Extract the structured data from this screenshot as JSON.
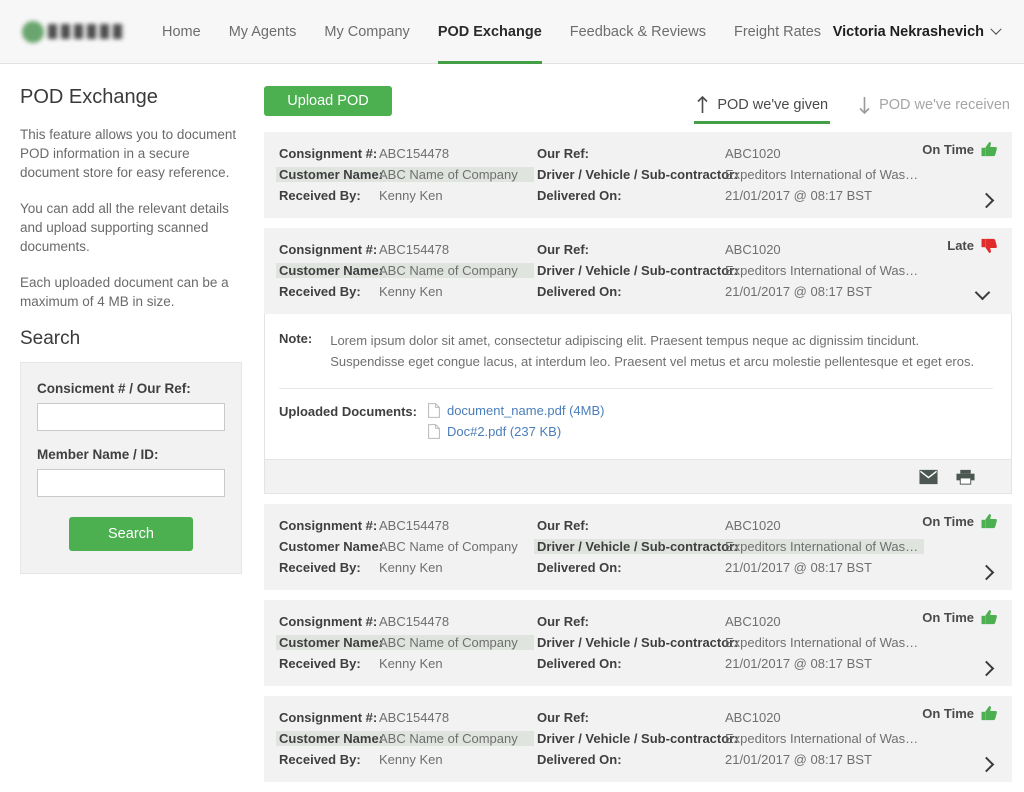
{
  "header": {
    "logo_name": "company-logo",
    "nav": [
      {
        "label": "Home",
        "active": false
      },
      {
        "label": "My Agents",
        "active": false
      },
      {
        "label": "My Company",
        "active": false
      },
      {
        "label": "POD Exchange",
        "active": true
      },
      {
        "label": "Feedback & Reviews",
        "active": false
      },
      {
        "label": "Freight Rates",
        "active": false
      }
    ],
    "user_name": "Victoria Nekrashevich"
  },
  "sidebar": {
    "title": "POD Exchange",
    "paragraphs": [
      "This feature allows you to document POD information in a secure document store for easy reference.",
      "You can add all the relevant details and upload supporting scanned documents.",
      "Each uploaded document can be a maximum of 4 MB in size."
    ],
    "search_heading": "Search",
    "consignment_label": "Consicment # / Our Ref:",
    "consignment_value": "",
    "member_label": "Member Name / ID:",
    "member_value": "",
    "search_button": "Search"
  },
  "toolbar": {
    "upload_label": "Upload POD",
    "tabs": [
      {
        "label": "POD we've given",
        "icon": "arrow-up-icon",
        "active": true
      },
      {
        "label": "POD we've receiven",
        "icon": "arrow-down-icon",
        "active": false
      }
    ]
  },
  "labels": {
    "consignment": "Consignment #:",
    "customer": "Customer Name:",
    "received_by": "Received By:",
    "our_ref": "Our Ref:",
    "driver": "Driver / Vehicle / Sub-contractor:",
    "delivered_on": "Delivered On:",
    "note": "Note:",
    "uploaded_documents": "Uploaded Documents:"
  },
  "records": [
    {
      "consignment": "ABC154478",
      "customer": "ABC Name of Company",
      "received_by": "Kenny Ken",
      "our_ref": "ABC1020",
      "driver": "Expeditors International of Washi...",
      "delivered_on": "21/01/2017 @ 08:17 BST",
      "status": "On Time",
      "status_type": "ontime",
      "highlight": "customer",
      "expanded": false
    },
    {
      "consignment": "ABC154478",
      "customer": "ABC Name of Company",
      "received_by": "Kenny Ken",
      "our_ref": "ABC1020",
      "driver": "Expeditors International of Washi...",
      "delivered_on": "21/01/2017 @ 08:17 BST",
      "status": "Late",
      "status_type": "late",
      "highlight": "customer",
      "expanded": true
    },
    {
      "consignment": "ABC154478",
      "customer": "ABC Name of Company",
      "received_by": "Kenny Ken",
      "our_ref": "ABC1020",
      "driver": "Expeditors International of Washi...",
      "delivered_on": "21/01/2017 @ 08:17 BST",
      "status": "On Time",
      "status_type": "ontime",
      "highlight": "driver",
      "expanded": false
    },
    {
      "consignment": "ABC154478",
      "customer": "ABC Name of Company",
      "received_by": "Kenny Ken",
      "our_ref": "ABC1020",
      "driver": "Expeditors International of Washi...",
      "delivered_on": "21/01/2017 @ 08:17 BST",
      "status": "On Time",
      "status_type": "ontime",
      "highlight": "customer",
      "expanded": false
    },
    {
      "consignment": "ABC154478",
      "customer": "ABC Name of Company",
      "received_by": "Kenny Ken",
      "our_ref": "ABC1020",
      "driver": "Expeditors International of Washi...",
      "delivered_on": "21/01/2017 @ 08:17 BST",
      "status": "On Time",
      "status_type": "ontime",
      "highlight": "customer",
      "expanded": false
    }
  ],
  "detail": {
    "note_text": "Lorem ipsum dolor sit amet, consectetur adipiscing elit. Praesent tempus neque ac dignissim tincidunt. Suspendisse eget congue lacus, at interdum leo. Praesent vel metus et arcu molestie pellentesque et eget eros.",
    "documents": [
      {
        "name": "document_name.pdf (4MB)"
      },
      {
        "name": "Doc#2.pdf (237 KB)"
      }
    ],
    "actions": [
      {
        "icon": "mail-icon"
      },
      {
        "icon": "print-icon"
      }
    ]
  },
  "colors": {
    "brand_green": "#4caf50",
    "accent_underline": "#43a047",
    "status_ontime": "#4caf50",
    "status_late": "#e02b2b",
    "link_blue": "#4a7ebb",
    "card_bg": "#f2f2f2",
    "highlight_bg": "#dfe4df"
  }
}
